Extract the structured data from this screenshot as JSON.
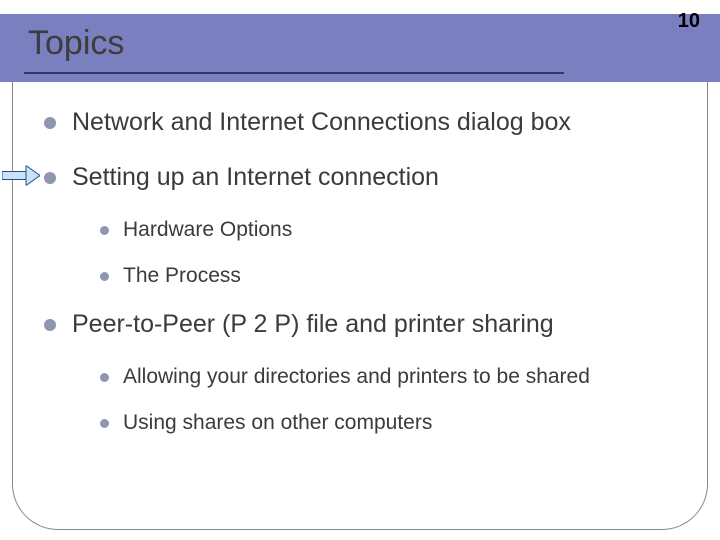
{
  "slide": {
    "page_number": "10",
    "title": "Topics",
    "items": [
      {
        "text": "Network and Internet Connections dialog box",
        "highlighted": false,
        "children": []
      },
      {
        "text": "Setting up an Internet connection",
        "highlighted": true,
        "children": [
          {
            "text": "Hardware Options"
          },
          {
            "text": "The Process"
          }
        ]
      },
      {
        "text": "Peer-to-Peer (P 2 P) file and printer sharing",
        "highlighted": false,
        "children": [
          {
            "text": "Allowing your directories and printers to be shared"
          },
          {
            "text": "Using shares on other computers"
          }
        ]
      }
    ]
  }
}
